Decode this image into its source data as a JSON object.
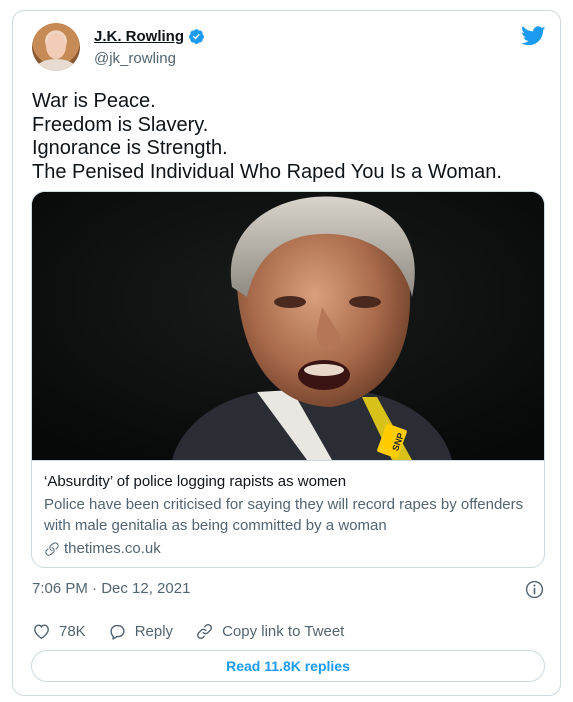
{
  "author": {
    "display_name": "J.K. Rowling",
    "handle": "@jk_rowling",
    "verified_icon": "verified-badge-icon"
  },
  "tweet": {
    "lines": [
      "War is Peace.",
      "Freedom is Slavery.",
      "Ignorance is Strength.",
      "The Penised Individual Who Raped You Is a Woman."
    ]
  },
  "link_card": {
    "title": "‘Absurdity’ of police logging rapists as women",
    "description": "Police have been criticised for saying they will record rapes by offenders with male genitalia as being committed by a woman",
    "domain": "thetimes.co.uk",
    "lanyard_text": "SNP"
  },
  "meta": {
    "timestamp": "7:06 PM · Dec 12, 2021"
  },
  "actions": {
    "likes": "78K",
    "reply_label": "Reply",
    "copy_label": "Copy link to Tweet"
  },
  "read_replies_label": "Read 11.8K replies",
  "colors": {
    "accent": "#1d9bf0",
    "text": "#0f1419",
    "secondary": "#536471",
    "border": "#cfd9de"
  }
}
